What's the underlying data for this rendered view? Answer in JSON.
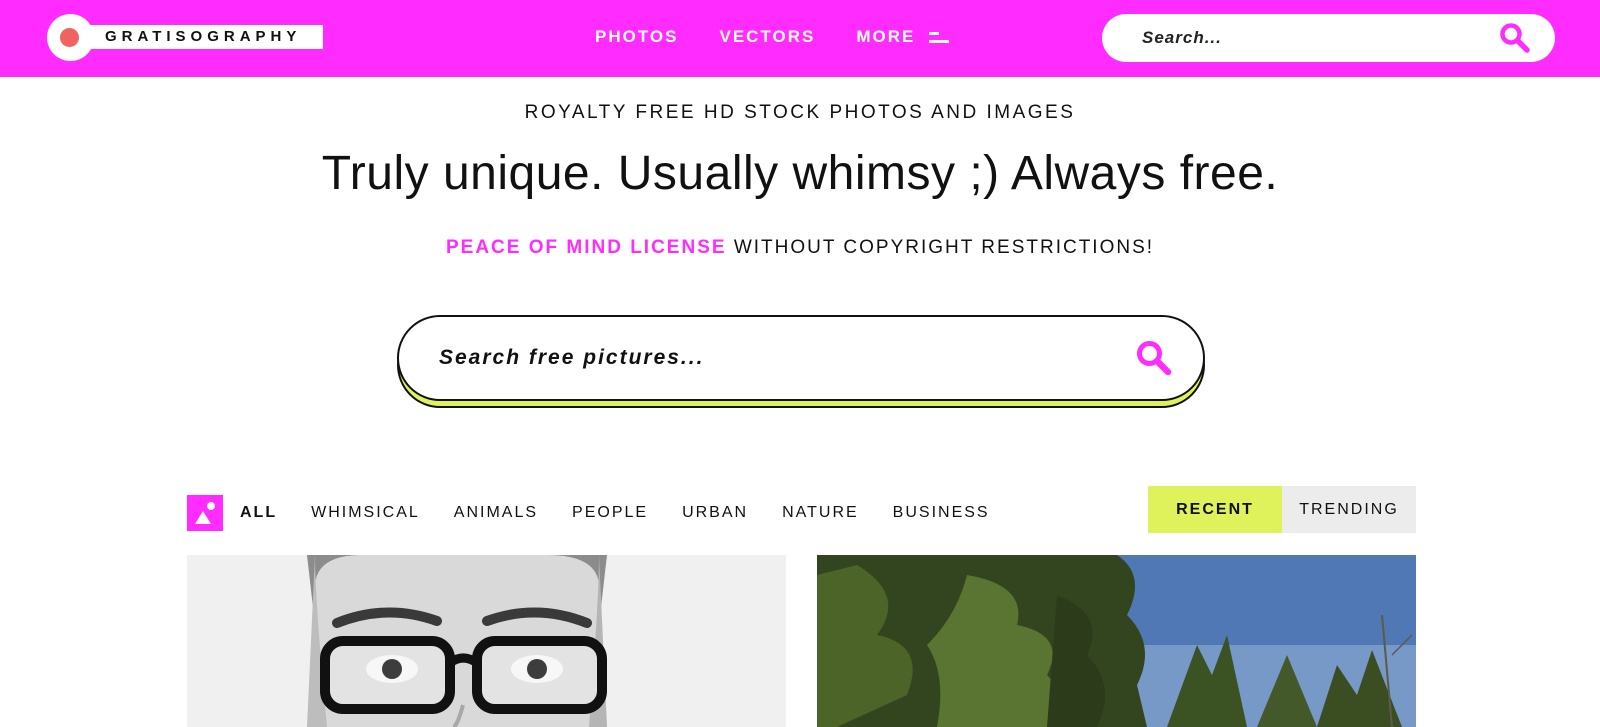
{
  "header": {
    "logo_text": "GRATISOGRAPHY",
    "nav": [
      {
        "label": "PHOTOS"
      },
      {
        "label": "VECTORS"
      },
      {
        "label": "MORE",
        "icon": "menu-icon"
      }
    ],
    "search": {
      "placeholder": "Search...",
      "icon": "search-icon"
    }
  },
  "hero": {
    "eyebrow": "ROYALTY FREE HD STOCK PHOTOS AND IMAGES",
    "headline": "Truly unique. Usually whimsy ;) Always free.",
    "license_accent": "PEACE OF MIND LICENSE",
    "license_rest": " WITHOUT COPYRIGHT RESTRICTIONS!",
    "search": {
      "placeholder": "Search free pictures...",
      "icon": "search-icon"
    }
  },
  "filters": {
    "categories": [
      {
        "label": "ALL",
        "active": true
      },
      {
        "label": "WHIMSICAL"
      },
      {
        "label": "ANIMALS"
      },
      {
        "label": "PEOPLE"
      },
      {
        "label": "URBAN"
      },
      {
        "label": "NATURE"
      },
      {
        "label": "BUSINESS"
      }
    ],
    "sort": {
      "recent": "RECENT",
      "trending": "TRENDING",
      "selected": "RECENT"
    }
  },
  "photos": [
    {
      "subject": "man with glasses and beanie, black and white"
    },
    {
      "subject": "evergreen trees under blue sky"
    }
  ],
  "colors": {
    "brand_magenta": "#ff2bff",
    "accent_lime": "#dff25c",
    "logo_dot": "#f0645f"
  }
}
